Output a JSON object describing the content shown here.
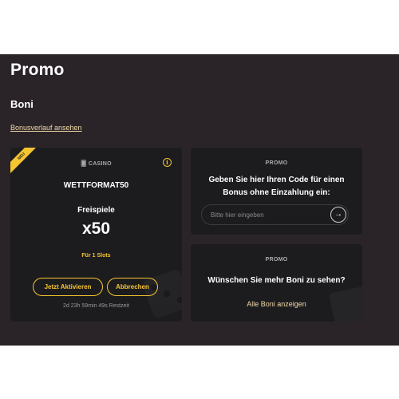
{
  "page": {
    "title": "Promo",
    "subtitle": "Boni",
    "history_link": "Bonusverlauf ansehen"
  },
  "bonus_card": {
    "ribbon": "NEU",
    "category": "CASINO",
    "info_icon": "info-icon",
    "code": "WETTFORMAT50",
    "type_label": "Freispiele",
    "multiplier": "x50",
    "slots_note": "Für 1 Slots",
    "activate_label": "Jetzt Aktivieren",
    "cancel_label": "Abbrechen",
    "time_left": "2d 23h 59min 49s Restzeit"
  },
  "promo_card": {
    "label": "PROMO",
    "heading": "Geben Sie hier Ihren Code für einen Bonus ohne Einzahlung ein:",
    "input_placeholder": "Bitte hier eingeben",
    "submit_icon": "arrow-right-icon"
  },
  "more_card": {
    "label": "PROMO",
    "heading": "Wünschen Sie mehr Boni zu sehen?",
    "link": "Alle Boni anzeigen"
  },
  "colors": {
    "background": "#2a2428",
    "card": "#1c1c1e",
    "accent": "#f5c431",
    "link": "#f1d9a8"
  }
}
